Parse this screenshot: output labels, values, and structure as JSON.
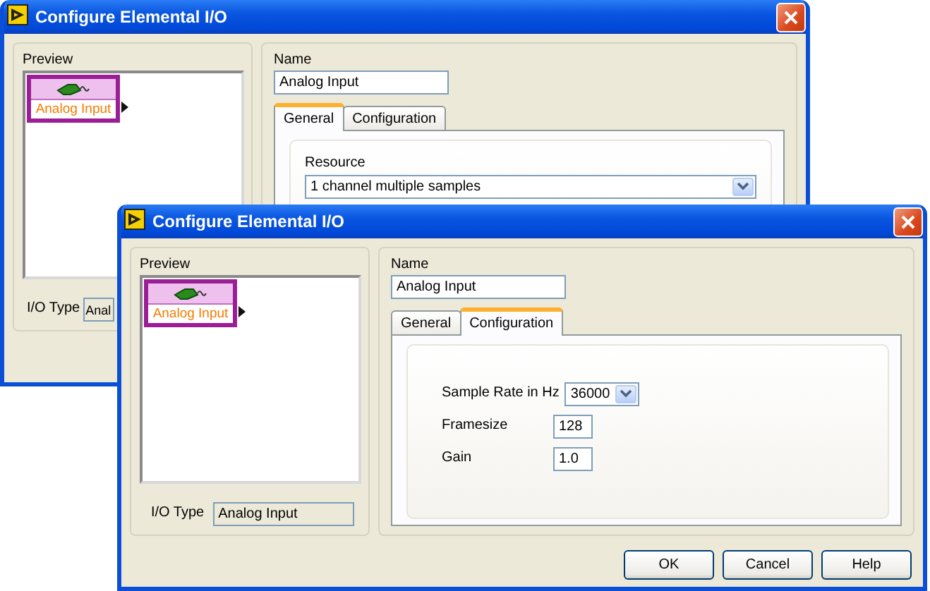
{
  "windows": [
    {
      "title": "Configure Elemental I/O",
      "preview": {
        "label": "Preview",
        "node_label": "Analog Input"
      },
      "io_type": {
        "label": "I/O Type",
        "value": "Anal"
      },
      "name": {
        "label": "Name",
        "value": "Analog Input"
      },
      "tabs": [
        {
          "label": "General",
          "selected": true
        },
        {
          "label": "Configuration",
          "selected": false
        }
      ],
      "fields": [
        {
          "kind": "dropdown-stacked",
          "label": "Resource",
          "value": "1 channel multiple samples"
        }
      ]
    },
    {
      "title": "Configure Elemental I/O",
      "preview": {
        "label": "Preview",
        "node_label": "Analog Input"
      },
      "io_type": {
        "label": "I/O Type",
        "value": "Analog Input"
      },
      "name": {
        "label": "Name",
        "value": "Analog Input"
      },
      "tabs": [
        {
          "label": "General",
          "selected": false
        },
        {
          "label": "Configuration",
          "selected": true
        }
      ],
      "fields": [
        {
          "kind": "dropdown",
          "label": "Sample Rate in Hz",
          "value": "36000"
        },
        {
          "kind": "text",
          "label": "Framesize",
          "value": "128"
        },
        {
          "kind": "text",
          "label": "Gain",
          "value": "1.0"
        }
      ],
      "buttons": [
        "OK",
        "Cancel",
        "Help"
      ]
    }
  ]
}
